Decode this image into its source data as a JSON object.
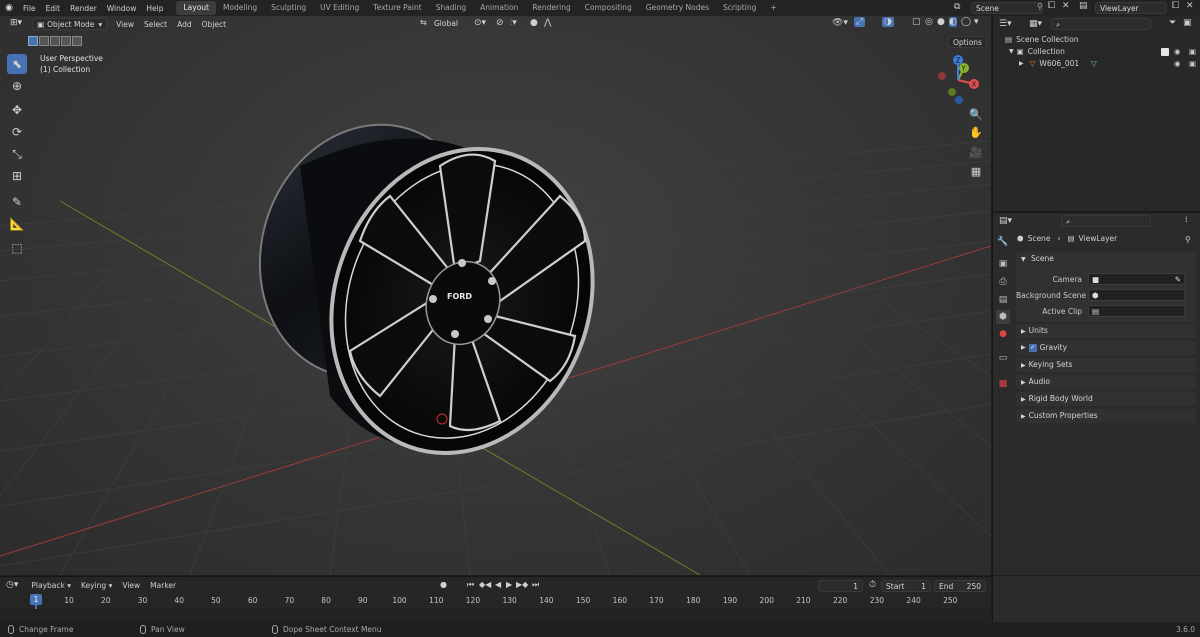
{
  "topbar": {
    "menus": [
      "File",
      "Edit",
      "Render",
      "Window",
      "Help"
    ],
    "workspaces": [
      "Layout",
      "Modeling",
      "Sculpting",
      "UV Editing",
      "Texture Paint",
      "Shading",
      "Animation",
      "Rendering",
      "Compositing",
      "Geometry Nodes",
      "Scripting"
    ],
    "active_workspace": "Layout",
    "add_tab": "+",
    "scene_name": "Scene",
    "view_layer": "ViewLayer"
  },
  "viewport": {
    "mode": "Object Mode",
    "menus": [
      "View",
      "Select",
      "Add",
      "Object"
    ],
    "transform_orientation": "Global",
    "overlay_title": "User Perspective",
    "overlay_collection": "(1) Collection",
    "options_label": "Options",
    "gizmo": {
      "x": "X",
      "y": "Y",
      "z": "Z"
    },
    "wheel_logo": "FORD"
  },
  "outliner": {
    "search_placeholder": "",
    "root": "Scene Collection",
    "collection": "Collection",
    "object": "W606_001"
  },
  "properties": {
    "search_placeholder": "",
    "breadcrumb_scene": "Scene",
    "breadcrumb_sep": "›",
    "breadcrumb_layer": "ViewLayer",
    "scene_panel": "Scene",
    "camera_label": "Camera",
    "background_label": "Background Scene",
    "clip_label": "Active Clip",
    "panels": [
      "Units",
      "Gravity",
      "Keying Sets",
      "Audio",
      "Rigid Body World",
      "Custom Properties"
    ],
    "gravity_checked": true
  },
  "timeline": {
    "menus": [
      "Playback",
      "Keying",
      "View",
      "Marker"
    ],
    "current_frame": "1",
    "start_label": "Start",
    "start": "1",
    "end_label": "End",
    "end": "250",
    "ruler_ticks": [
      "10",
      "20",
      "30",
      "40",
      "50",
      "60",
      "70",
      "80",
      "90",
      "100",
      "110",
      "120",
      "130",
      "140",
      "150",
      "160",
      "170",
      "180",
      "190",
      "200",
      "210",
      "220",
      "230",
      "240",
      "250"
    ],
    "playhead": "1"
  },
  "statusbar": {
    "items": [
      "Change Frame",
      "Pan View",
      "Dope Sheet Context Menu"
    ],
    "version": "3.6.0"
  },
  "colors": {
    "accent": "#4772b3",
    "axis_x": "#e24f4f",
    "axis_y": "#86b42d",
    "axis_z": "#3d7ee0"
  }
}
